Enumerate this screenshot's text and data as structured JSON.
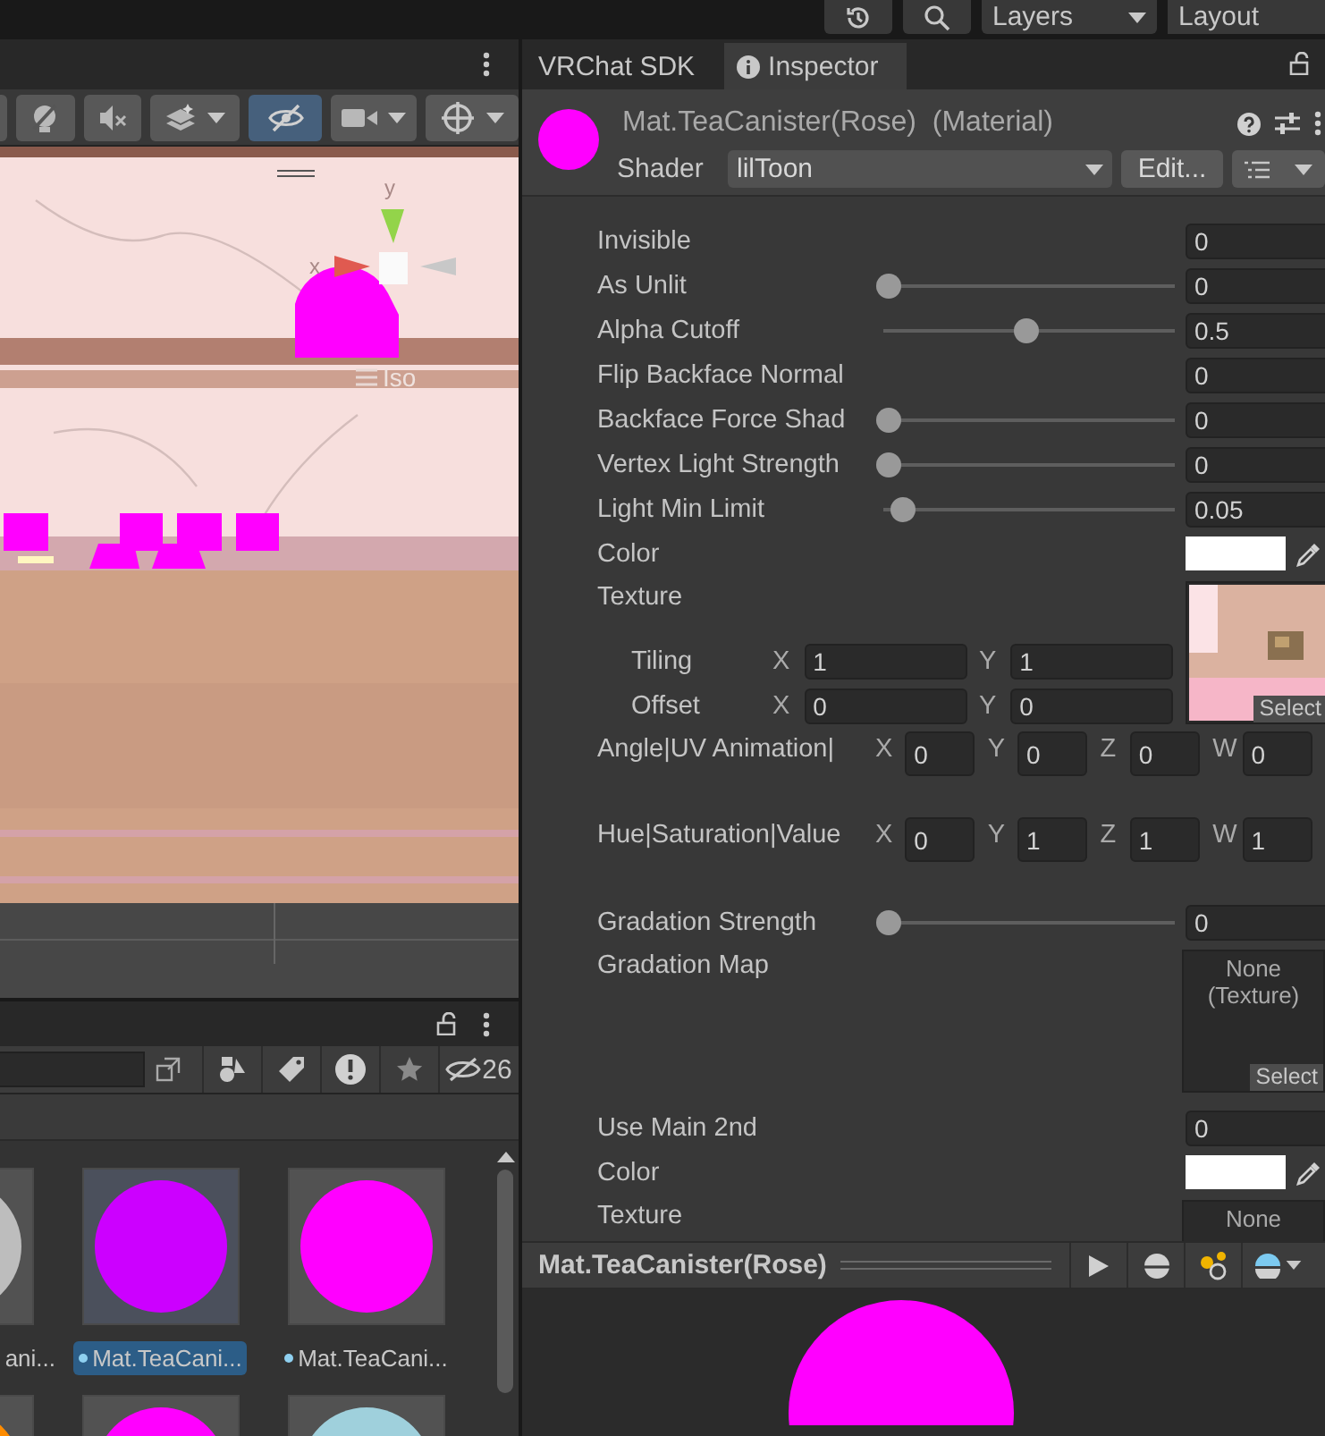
{
  "topbar": {
    "layers": "Layers",
    "layout": "Layout"
  },
  "scene_toolbar": [
    {
      "kind": "blank",
      "selected": false,
      "dropdown": false
    },
    {
      "kind": "lighting",
      "selected": false,
      "dropdown": false
    },
    {
      "kind": "audio",
      "selected": false,
      "dropdown": false
    },
    {
      "kind": "effects",
      "selected": false,
      "dropdown": true
    },
    {
      "kind": "visibility",
      "selected": true,
      "dropdown": false
    },
    {
      "kind": "camera",
      "selected": false,
      "dropdown": true
    },
    {
      "kind": "gizmos",
      "selected": false,
      "dropdown": true
    }
  ],
  "scene": {
    "kind": "picture",
    "gizmo_y": "y",
    "gizmo_x": "x",
    "projection": "Iso"
  },
  "project": {
    "hidden_count": "26",
    "items": [
      {
        "label": "ani...",
        "color": "#bdbdbd",
        "selected": false
      },
      {
        "label": "Mat.TeaCani...",
        "color": "#cc00ff",
        "selected": true
      },
      {
        "label": "Mat.TeaCani...",
        "color": "#ff00ff",
        "selected": false
      },
      {
        "color": "#ff8c00"
      },
      {
        "color": "#ff00ff"
      },
      {
        "color": "#9fd0dc"
      }
    ]
  },
  "inspector": {
    "tabs": [
      {
        "label": "VRChat SDK",
        "selected": false
      },
      {
        "label": "Inspector",
        "selected": true
      }
    ],
    "title": "Mat.TeaCanister(Rose)  (Material)",
    "shader_label": "Shader",
    "shader": "lilToon",
    "edit": "Edit...",
    "properties": [
      {
        "kind": "number",
        "label": "Invisible",
        "value": "0"
      },
      {
        "kind": "slider",
        "label": "As Unlit",
        "level": 0,
        "value": "0"
      },
      {
        "kind": "slider",
        "label": "Alpha Cutoff",
        "level": 0.5,
        "value": "0.5"
      },
      {
        "kind": "number",
        "label": "Flip Backface Normal",
        "value": "0"
      },
      {
        "kind": "slider",
        "label": "Backface Force Shad",
        "level": 0,
        "value": "0"
      },
      {
        "kind": "slider",
        "label": "Vertex Light Strength",
        "level": 0,
        "value": "0"
      },
      {
        "kind": "slider",
        "label": "Light Min Limit",
        "level": 0.05,
        "value": "0.05"
      },
      {
        "kind": "color",
        "label": "Color",
        "color": "#ffffff"
      },
      {
        "kind": "texture",
        "label": "Texture",
        "select": "Select",
        "rows": [
          {
            "label": "Tiling",
            "fields": [
              {
                "axis": "X",
                "value": "1"
              },
              {
                "axis": "Y",
                "value": "1"
              }
            ]
          },
          {
            "label": "Offset",
            "fields": [
              {
                "axis": "X",
                "value": "0"
              },
              {
                "axis": "Y",
                "value": "0"
              }
            ]
          }
        ]
      },
      {
        "kind": "vector4",
        "label": "Angle|UV Animation|",
        "fields": [
          {
            "axis": "X",
            "value": "0"
          },
          {
            "axis": "Y",
            "value": "0"
          },
          {
            "axis": "Z",
            "value": "0"
          },
          {
            "axis": "W",
            "value": "0"
          }
        ]
      },
      {
        "kind": "vector4",
        "label": "Hue|Saturation|Value",
        "fields": [
          {
            "axis": "X",
            "value": "0"
          },
          {
            "axis": "Y",
            "value": "1"
          },
          {
            "axis": "Z",
            "value": "1"
          },
          {
            "axis": "W",
            "value": "1"
          }
        ]
      },
      {
        "kind": "slider",
        "label": "Gradation Strength",
        "level": 0,
        "value": "0"
      },
      {
        "kind": "texture",
        "label": "Gradation Map",
        "none_text": "None (Texture)",
        "select": "Select"
      },
      {
        "kind": "number",
        "label": "Use Main 2nd",
        "value": "0"
      },
      {
        "kind": "color",
        "label": "Color",
        "color": "#ffffff"
      },
      {
        "kind": "texture",
        "label": "Texture",
        "none_text": "None"
      }
    ]
  },
  "preview": {
    "title": "Mat.TeaCanister(Rose)"
  }
}
